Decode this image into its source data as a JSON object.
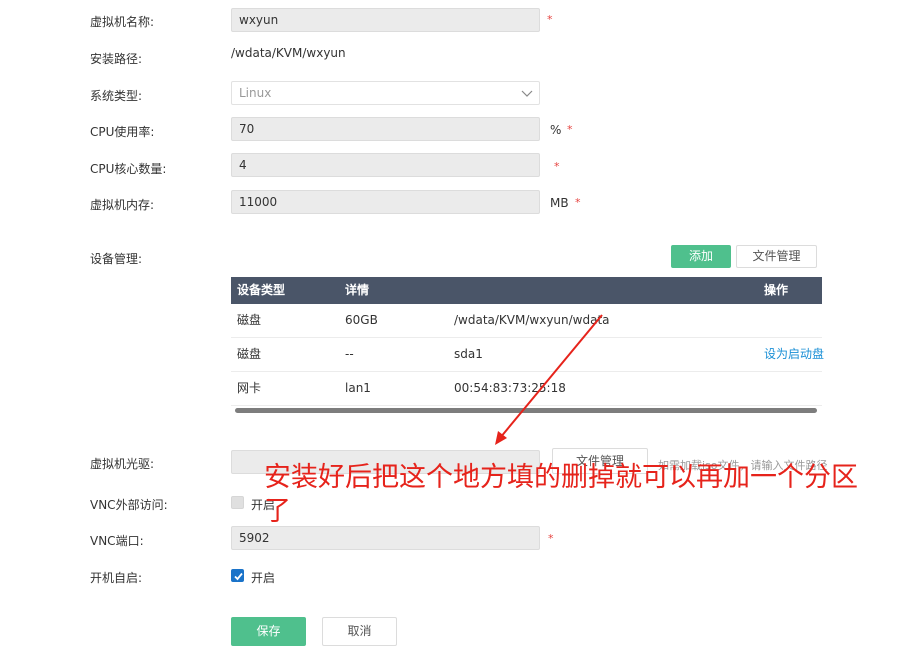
{
  "form": {
    "vm_name_label": "虚拟机名称:",
    "vm_name_value": "wxyun",
    "install_path_label": "安装路径:",
    "install_path_value": "/wdata/KVM/wxyun",
    "os_type_label": "系统类型:",
    "os_type_value": "Linux",
    "cpu_usage_label": "CPU使用率:",
    "cpu_usage_value": "70",
    "cpu_usage_unit": "%",
    "cpu_cores_label": "CPU核心数量:",
    "cpu_cores_value": "4",
    "memory_label": "虚拟机内存:",
    "memory_value": "11000",
    "memory_unit": "MB",
    "required_mark": "*",
    "device_mgmt_label": "设备管理:",
    "add_button": "添加",
    "file_mgmt_button": "文件管理",
    "cdrom_label": "虚拟机光驱:",
    "cdrom_value": "",
    "cdrom_file_button": "文件管理",
    "cdrom_hint": "如需加载iso文件，请输入文件路径",
    "vnc_access_label": "VNC外部访问:",
    "vnc_access_option": "开启",
    "vnc_access_checked": false,
    "vnc_port_label": "VNC端口:",
    "vnc_port_value": "5902",
    "autostart_label": "开机自启:",
    "autostart_option": "开启",
    "autostart_checked": true,
    "save_button": "保存",
    "cancel_button": "取消"
  },
  "devices": {
    "headers": {
      "type": "设备类型",
      "detail": "详情",
      "action": "操作"
    },
    "rows": [
      {
        "type": "磁盘",
        "size": "60GB",
        "path": "/wdata/KVM/wxyun/wdata",
        "action": ""
      },
      {
        "type": "磁盘",
        "size": "--",
        "path": "sda1",
        "action": "设为启动盘"
      },
      {
        "type": "网卡",
        "size": "lan1",
        "path": "00:54:83:73:25:18",
        "action": ""
      }
    ]
  },
  "annotation": {
    "text": "安装好后把这个地方填的删掉就可以再加一个分区了",
    "color": "#e6231b"
  },
  "colors": {
    "accent_green": "#4fc08d",
    "table_header": "#4a5568",
    "link_blue": "#1a8fd6",
    "required_red": "#e64340"
  }
}
